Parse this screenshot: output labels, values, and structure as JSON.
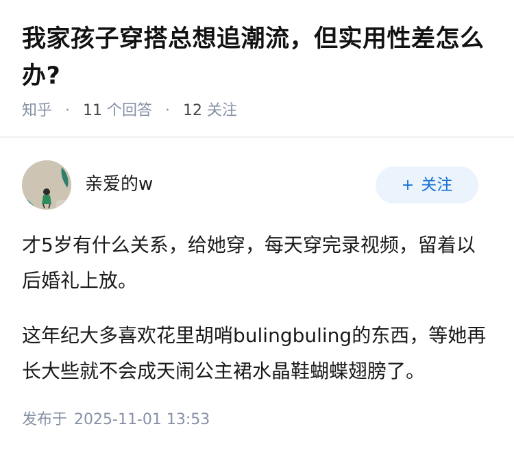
{
  "question": {
    "title": "我家孩子穿搭总想追潮流，但实用性差怎么办?",
    "source": "知乎",
    "answer_count": "11",
    "answer_label": "个回答",
    "follow_count": "12",
    "follow_label": "关注",
    "separator": "·"
  },
  "author": {
    "name": "亲爱的w",
    "avatar_icon": "avatar-image",
    "follow_button": {
      "plus": "+",
      "label": "关注"
    }
  },
  "answer": {
    "paragraphs": [
      "才5岁有什么关系，给她穿，每天穿完录视频，留着以后婚礼上放。",
      "这年纪大多喜欢花里胡哨bulingbuling的东西，等她再长大些就不会成天闹公主裙水晶鞋蝴蝶翅膀了。"
    ]
  },
  "published": {
    "label": "发布于",
    "date": "2025-11-01 13:53"
  },
  "colors": {
    "accent": "#1772d6",
    "button_bg": "#ebf3fc",
    "meta_gray": "#8590a6",
    "title": "#121212"
  }
}
